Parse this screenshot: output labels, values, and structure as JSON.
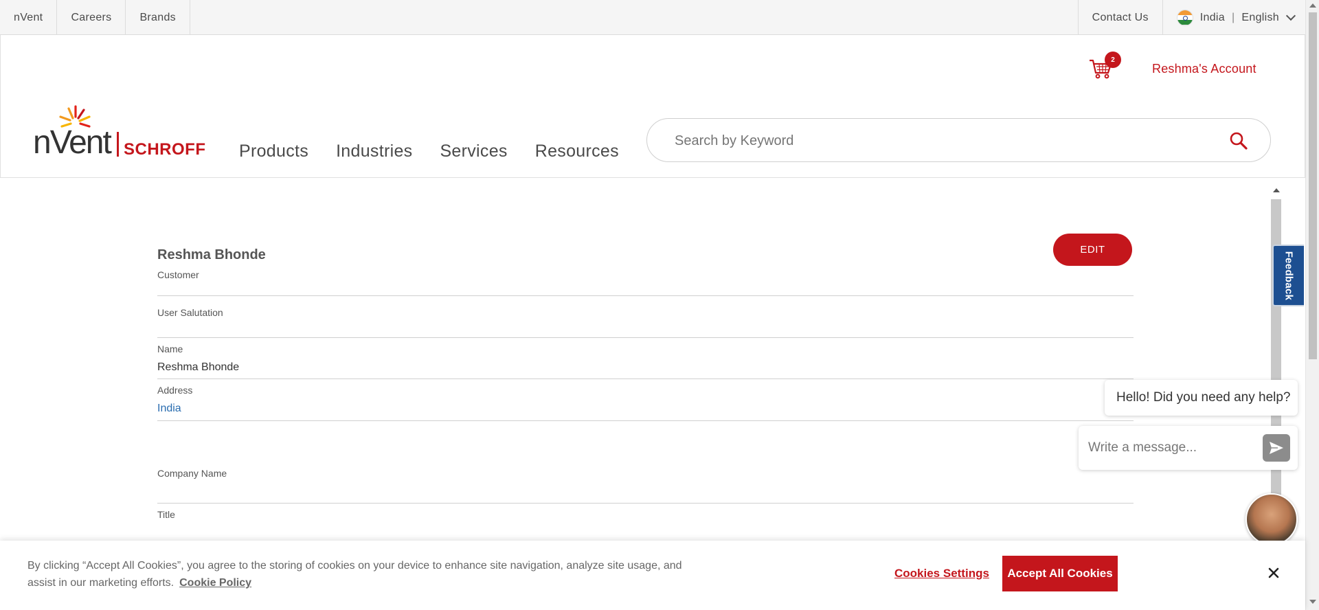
{
  "topbar": {
    "links": [
      "nVent",
      "Careers",
      "Brands"
    ],
    "contact": "Contact Us",
    "country": "India",
    "separator": "|",
    "language": "English"
  },
  "header": {
    "cart_count": "2",
    "account": "Reshma's Account",
    "logo_primary": "nVent",
    "logo_secondary": "SCHROFF",
    "nav": [
      "Products",
      "Industries",
      "Services",
      "Resources"
    ],
    "search_placeholder": "Search by Keyword"
  },
  "profile": {
    "name": "Reshma Bhonde",
    "role": "Customer",
    "edit_label": "EDIT",
    "fields": {
      "salutation": {
        "label": "User Salutation",
        "value": ""
      },
      "name": {
        "label": "Name",
        "value": "Reshma Bhonde"
      },
      "address": {
        "label": "Address",
        "value": "India"
      },
      "company": {
        "label": "Company Name",
        "value": ""
      },
      "title": {
        "label": "Title",
        "value": ""
      }
    }
  },
  "feedback": {
    "label": "Feedback"
  },
  "chat": {
    "greeting": "Hello! Did you need any help?",
    "input_placeholder": "Write a message..."
  },
  "cookie": {
    "text": "By clicking “Accept All Cookies”, you agree to the storing of cookies on your device to enhance site navigation, analyze site usage, and assist in our marketing efforts.",
    "policy_link": "Cookie Policy",
    "settings_label": "Cookies Settings",
    "accept_label": "Accept All Cookies"
  },
  "colors": {
    "brand_red": "#c4161c",
    "link_blue": "#2a6db0",
    "feedback_blue": "#1d4f91"
  }
}
